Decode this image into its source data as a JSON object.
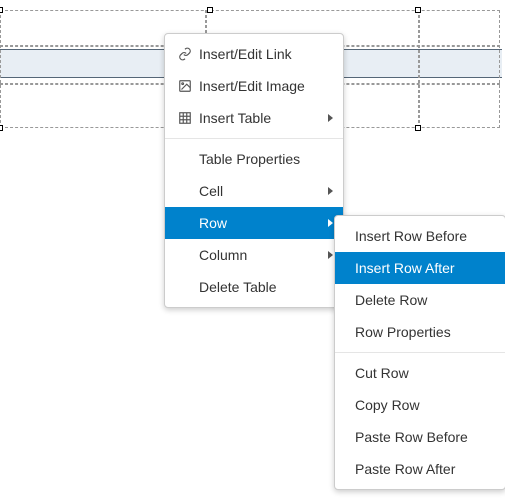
{
  "menu": {
    "insert_link": "Insert/Edit Link",
    "insert_image": "Insert/Edit Image",
    "insert_table": "Insert Table",
    "table_props": "Table Properties",
    "cell": "Cell",
    "row": "Row",
    "column": "Column",
    "delete_table": "Delete Table"
  },
  "row_submenu": {
    "insert_before": "Insert Row Before",
    "insert_after": "Insert Row After",
    "delete_row": "Delete Row",
    "row_props": "Row Properties",
    "cut_row": "Cut Row",
    "copy_row": "Copy Row",
    "paste_before": "Paste Row Before",
    "paste_after": "Paste Row After"
  },
  "state": {
    "highlighted_main": "row",
    "highlighted_sub": "insert_after"
  }
}
